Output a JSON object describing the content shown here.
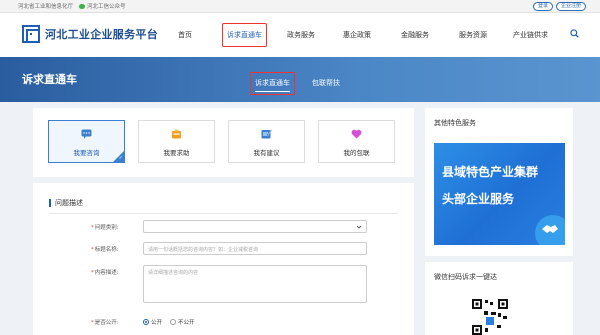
{
  "topbar": {
    "org_link": "河北省工业和信息化厅",
    "wechat_link": "河北工信公众号",
    "login": "登录",
    "register": "企业注册"
  },
  "header": {
    "logo_text": "河北工业企业服务平台",
    "nav": [
      "首页",
      "诉求直通车",
      "政务服务",
      "惠企政策",
      "金融服务",
      "服务资源",
      "产业链供求"
    ],
    "active_nav": "诉求直通车"
  },
  "banner": {
    "title": "诉求直通车",
    "tabs": [
      "诉求直通车",
      "包联帮扶"
    ],
    "active_tab": "诉求直通车"
  },
  "categories": [
    {
      "label": "我要咨询",
      "icon": "chat-icon",
      "color": "#3a7fd0",
      "active": true
    },
    {
      "label": "我要求助",
      "icon": "help-icon",
      "color": "#f0a020",
      "active": false
    },
    {
      "label": "我有建议",
      "icon": "suggestion-icon",
      "color": "#3a7fd0",
      "active": false
    },
    {
      "label": "我的包联",
      "icon": "heart-icon",
      "color": "#d74fd8",
      "active": false
    }
  ],
  "form": {
    "section_title": "问题描述",
    "type_label": "问题类别:",
    "subject_label": "标题名称:",
    "subject_placeholder": "请用一句话概括您的咨询内容？如：企业减税咨询",
    "content_label": "内容描述:",
    "content_placeholder": "请详细描述咨询的内容",
    "public_label": "是否公开:",
    "public_options": [
      "公开",
      "不公开"
    ],
    "public_selected": "公开"
  },
  "sidebar": {
    "featured_title": "其他特色服务",
    "banner_line1": "县域特色产业集群",
    "banner_line2": "头部企业服务",
    "qr_title": "微信扫码诉求一键达"
  },
  "colors": {
    "brand": "#1d5fb3",
    "highlight": "#e33333"
  }
}
